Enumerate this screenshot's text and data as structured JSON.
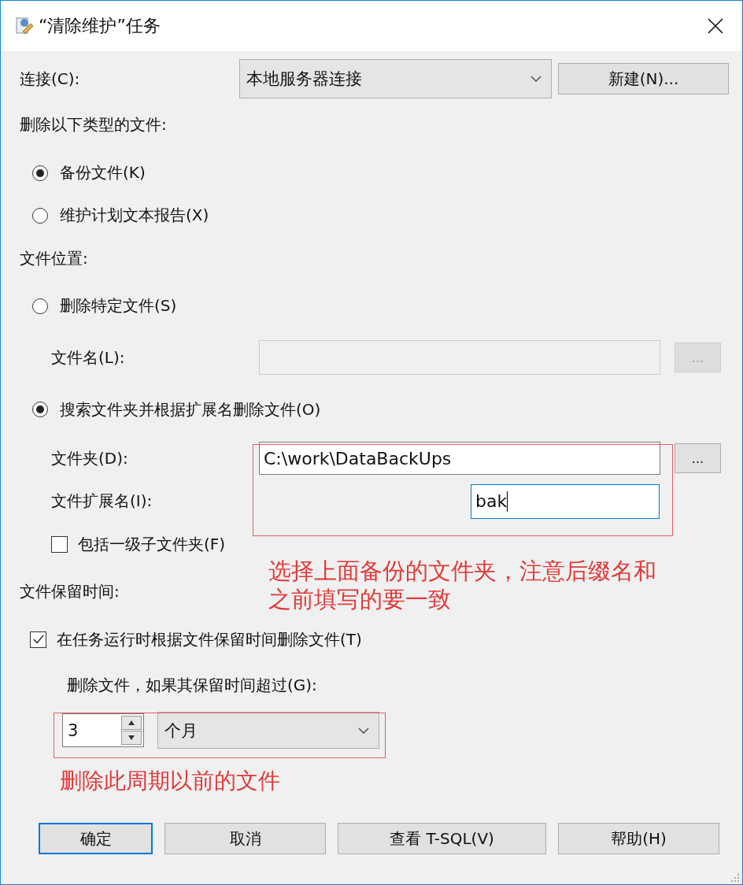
{
  "window": {
    "title": "“清除维护”任务"
  },
  "connection": {
    "label": "连接(C):",
    "value": "本地服务器连接",
    "new_button": "新建(N)..."
  },
  "file_type": {
    "heading": "删除以下类型的文件:",
    "options": [
      {
        "label": "备份文件(K)",
        "selected": true
      },
      {
        "label": "维护计划文本报告(X)",
        "selected": false
      }
    ]
  },
  "location": {
    "heading": "文件位置:",
    "specific": {
      "label": "删除特定文件(S)",
      "selected": false,
      "filename_label": "文件名(L):",
      "browse": "...",
      "disabled": true
    },
    "search": {
      "label": "搜索文件夹并根据扩展名删除文件(O)",
      "selected": true,
      "folder_label": "文件夹(D):",
      "folder": "C:\\work\\DataBackUps",
      "browse": "...",
      "extension_label": "文件扩展名(I):",
      "extension": "bak",
      "include_subfolders": {
        "label": "包括一级子文件夹(F)",
        "checked": false
      }
    }
  },
  "retention": {
    "heading": "文件保留时间:",
    "enable": {
      "label": "在任务运行时根据文件保留时间删除文件(T)",
      "checked": true
    },
    "prompt": "删除文件，如果其保留时间超过(G):",
    "amount": "3",
    "unit": "个月"
  },
  "annotations": [
    {
      "text": "选择上面备份的文件夹，注意后缀名和之前填写的要一致"
    },
    {
      "text": "删除此周期以前的文件"
    }
  ],
  "buttons": [
    {
      "label": "确定",
      "default": true
    },
    {
      "label": "取消",
      "default": false
    },
    {
      "label": "查看 T-SQL(V)",
      "default": false
    },
    {
      "label": "帮助(H)",
      "default": false
    }
  ]
}
